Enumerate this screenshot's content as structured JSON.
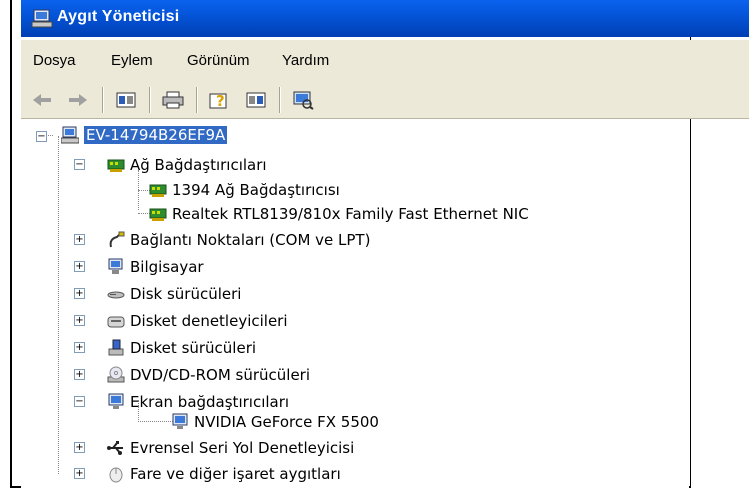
{
  "window": {
    "title": "Aygıt Yöneticisi"
  },
  "menu": [
    "Dosya",
    "Eylem",
    "Görünüm",
    "Yardım"
  ],
  "toolbar": [
    "back-arrow-icon",
    "forward-arrow-icon",
    "properties-icon",
    "print-icon",
    "help-icon",
    "panel-icon",
    "scan-hardware-icon"
  ],
  "tree": {
    "root": "EV-14794B26EF9A",
    "nodes": [
      {
        "label": "Ağ Bağdaştırıcıları",
        "expanded": true,
        "icon": "network-adapter-icon",
        "children": [
          "1394 Ağ Bağdaştırıcısı",
          "Realtek RTL8139/810x Family Fast Ethernet NIC"
        ]
      },
      {
        "label": "Bağlantı Noktaları (COM ve LPT)",
        "icon": "port-icon"
      },
      {
        "label": "Bilgisayar",
        "icon": "computer-icon"
      },
      {
        "label": "Disk sürücüleri",
        "icon": "disk-drive-icon"
      },
      {
        "label": "Disket denetleyicileri",
        "icon": "floppy-controller-icon"
      },
      {
        "label": "Disket sürücüleri",
        "icon": "floppy-drive-icon"
      },
      {
        "label": "DVD/CD-ROM sürücüleri",
        "icon": "dvd-icon"
      },
      {
        "label": "Ekran bağdaştırıcıları",
        "expanded": true,
        "icon": "display-adapter-icon",
        "children": [
          "NVIDIA GeForce FX 5500"
        ]
      },
      {
        "label": "Evrensel Seri Yol Denetleyicisi",
        "icon": "usb-icon"
      },
      {
        "label": "Fare ve diğer işaret aygıtları",
        "icon": "mouse-icon"
      }
    ]
  }
}
